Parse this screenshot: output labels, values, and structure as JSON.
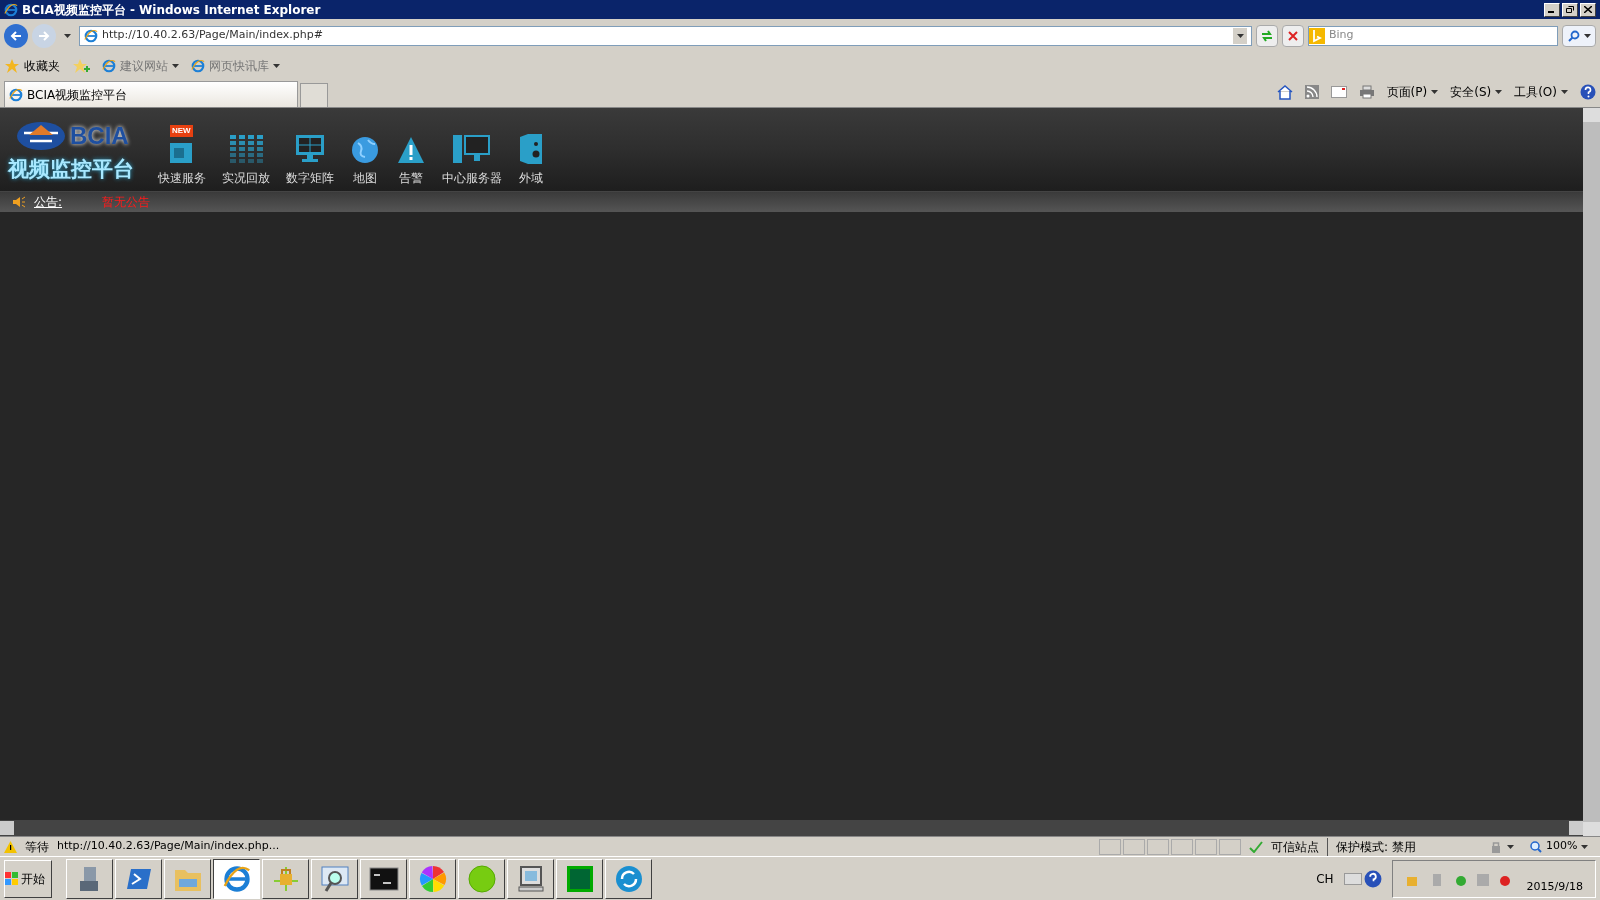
{
  "window": {
    "title": "BCIA视频监控平台 - Windows Internet Explorer"
  },
  "address_bar": {
    "url": "http://10.40.2.63/Page/Main/index.php#"
  },
  "search": {
    "placeholder": "Bing"
  },
  "favorites_bar": {
    "label": "收藏夹",
    "links": [
      "建议网站",
      "网页快讯库"
    ]
  },
  "tabs": [
    {
      "label": "BCIA视频监控平台",
      "selected": true
    }
  ],
  "command_bar": [
    "页面(P)",
    "安全(S)",
    "工具(O)"
  ],
  "page": {
    "logo": "BCIA",
    "subtitle": "视频监控平台",
    "nav": [
      {
        "kind": "service",
        "label": "快速服务",
        "badge": "NEW"
      },
      {
        "kind": "playback",
        "label": "实况回放"
      },
      {
        "kind": "matrix",
        "label": "数字矩阵"
      },
      {
        "kind": "map",
        "label": "地图"
      },
      {
        "kind": "alarm",
        "label": "告警"
      },
      {
        "kind": "server",
        "label": "中心服务器"
      },
      {
        "kind": "domain",
        "label": "外域"
      }
    ],
    "notice": {
      "label": "公告:",
      "text": "暂无公告"
    }
  },
  "status_bar": {
    "status": "等待",
    "url": "http://10.40.2.63/Page/Main/index.php...",
    "zone": "可信站点",
    "protected_mode": "保护模式: 禁用",
    "zoom": "100%"
  },
  "taskbar": {
    "start": "开始",
    "apps": [
      {
        "kind": "server",
        "selected": false
      },
      {
        "kind": "shell",
        "selected": false
      },
      {
        "kind": "folder",
        "selected": false
      },
      {
        "kind": "ie",
        "selected": true
      },
      {
        "kind": "lock",
        "selected": false
      },
      {
        "kind": "search",
        "selected": false
      },
      {
        "kind": "cmd",
        "selected": false
      },
      {
        "kind": "pinwheel",
        "selected": false
      },
      {
        "kind": "circle",
        "selected": false
      },
      {
        "kind": "monitor",
        "selected": false
      },
      {
        "kind": "terminal",
        "selected": false
      },
      {
        "kind": "sync",
        "selected": false
      }
    ],
    "language": "CH",
    "date": "2015/9/18"
  }
}
